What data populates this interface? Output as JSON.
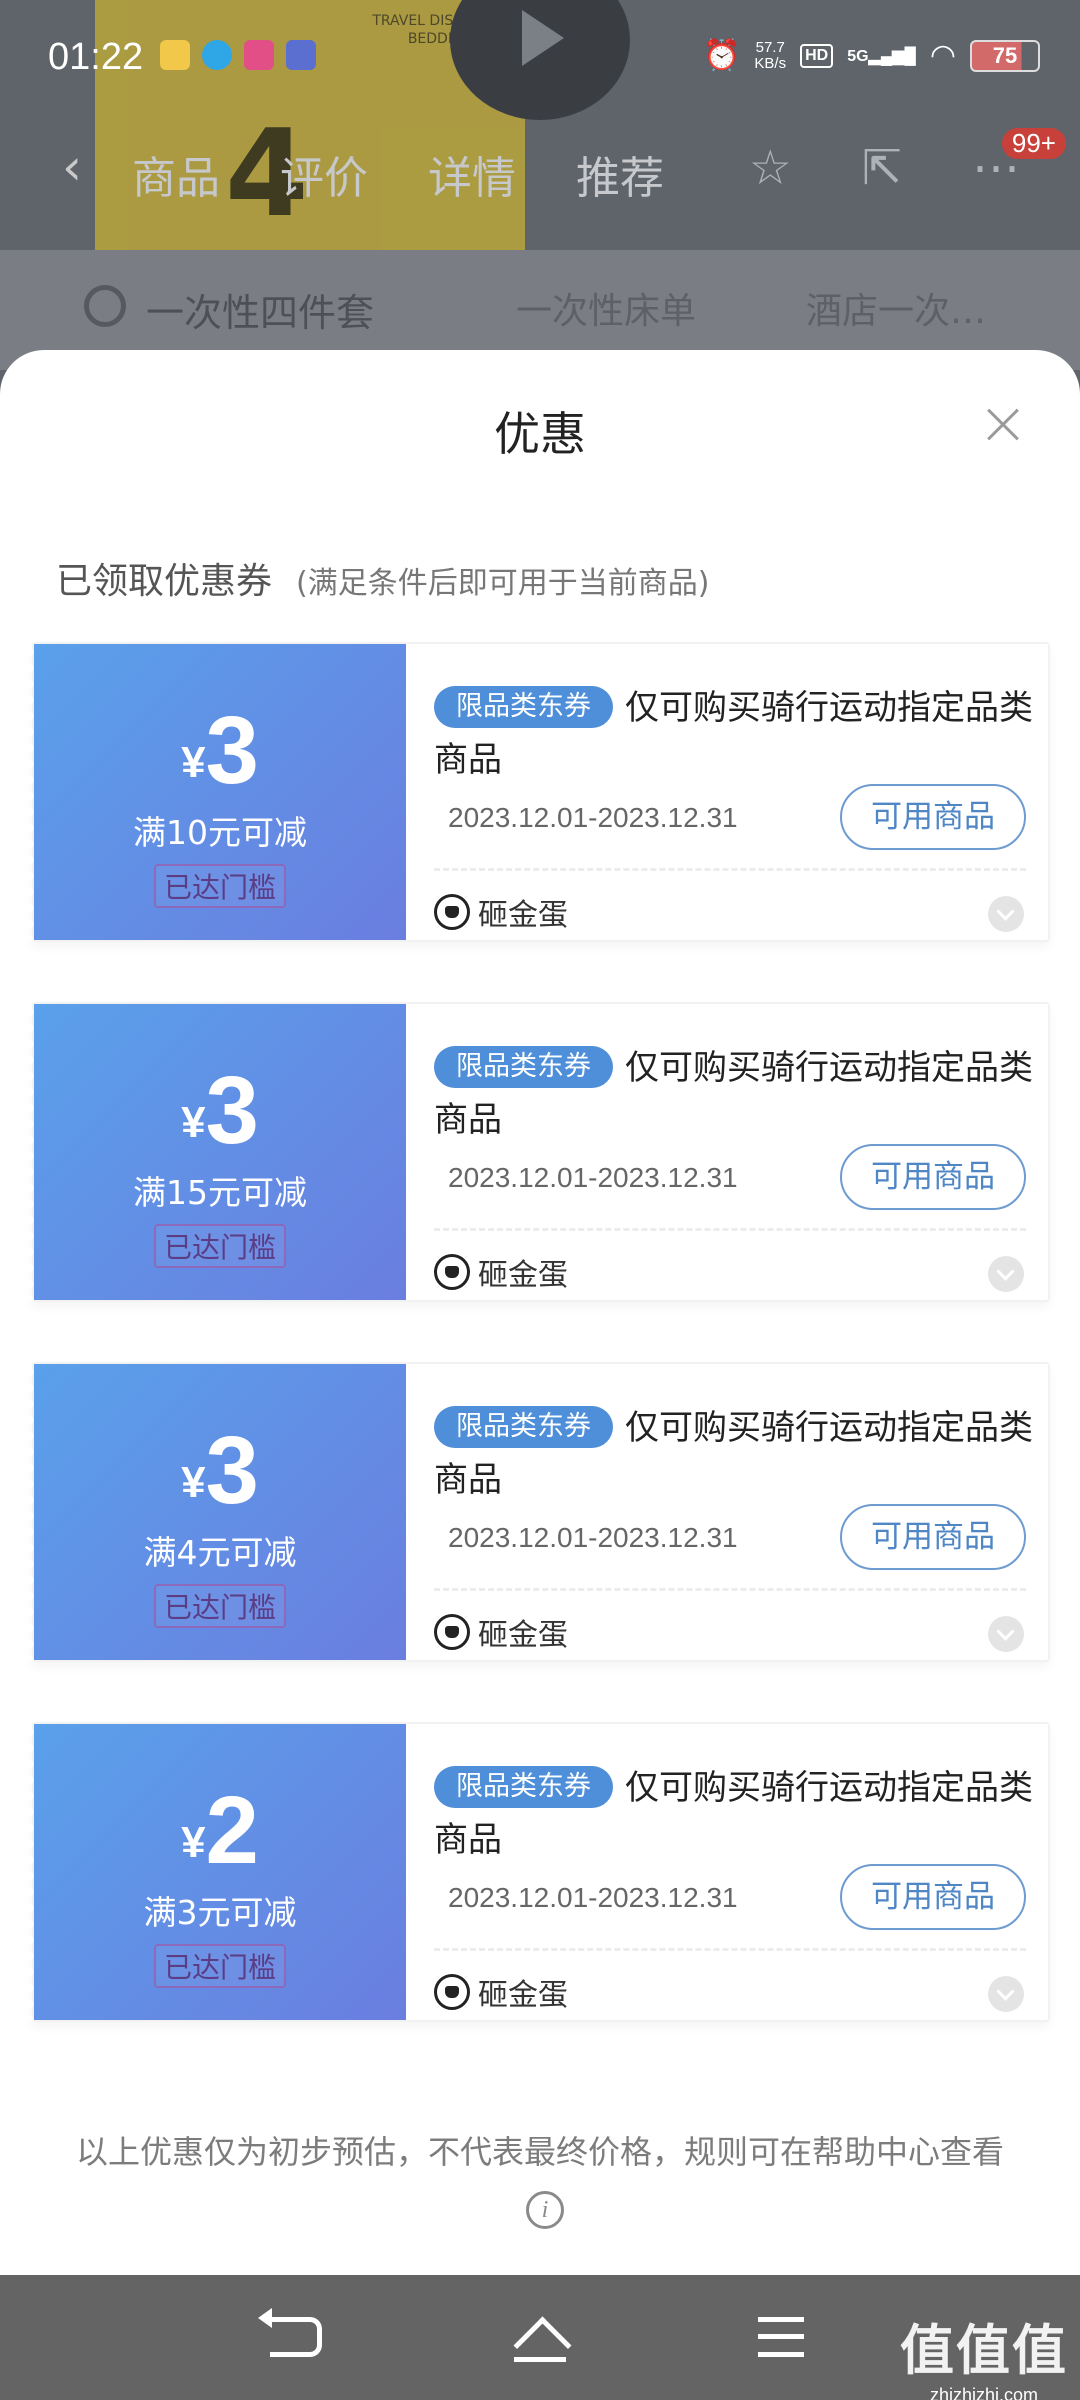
{
  "status_bar": {
    "time": "01:22",
    "net_speed_value": "57.7",
    "net_speed_unit": "KB/s",
    "hd": "HD",
    "network": "5G",
    "battery": "75"
  },
  "background": {
    "product_big_text": "4",
    "product_package_text": "TRAVEL DISPOSABLE BEDDINGS",
    "tabs": [
      "商品",
      "评价",
      "详情",
      "推荐"
    ],
    "cart_badge": "99+",
    "search_keywords": [
      "一次性四件套",
      "一次性床单",
      "酒店一次…"
    ]
  },
  "sheet": {
    "title": "优惠",
    "section_title": "已领取优惠券",
    "section_subtitle": "(满足条件后即可用于当前商品)",
    "footnote": "以上优惠仅为初步预估，不代表最终价格，规则可在帮助中心查看",
    "coupons": [
      {
        "currency": "¥",
        "amount": "3",
        "condition": "满10元可减",
        "status": "已达门槛",
        "tag": "限品类东券",
        "description": "仅可购买骑行运动指定品类商品",
        "validity": "2023.12.01-2023.12.31",
        "action": "可用商品",
        "source": "砸金蛋"
      },
      {
        "currency": "¥",
        "amount": "3",
        "condition": "满15元可减",
        "status": "已达门槛",
        "tag": "限品类东券",
        "description": "仅可购买骑行运动指定品类商品",
        "validity": "2023.12.01-2023.12.31",
        "action": "可用商品",
        "source": "砸金蛋"
      },
      {
        "currency": "¥",
        "amount": "3",
        "condition": "满4元可减",
        "status": "已达门槛",
        "tag": "限品类东券",
        "description": "仅可购买骑行运动指定品类商品",
        "validity": "2023.12.01-2023.12.31",
        "action": "可用商品",
        "source": "砸金蛋"
      },
      {
        "currency": "¥",
        "amount": "2",
        "condition": "满3元可减",
        "status": "已达门槛",
        "tag": "限品类东券",
        "description": "仅可购买骑行运动指定品类商品",
        "validity": "2023.12.01-2023.12.31",
        "action": "可用商品",
        "source": "砸金蛋"
      }
    ]
  },
  "watermark": {
    "main": "值值值",
    "sub": "zhizhizhi.com"
  },
  "colors": {
    "coupon_gradient_start": "#5aa0ea",
    "coupon_gradient_end": "#6a7ee0",
    "tag_blue": "#4f8fd9",
    "button_text": "#4f86c6"
  }
}
